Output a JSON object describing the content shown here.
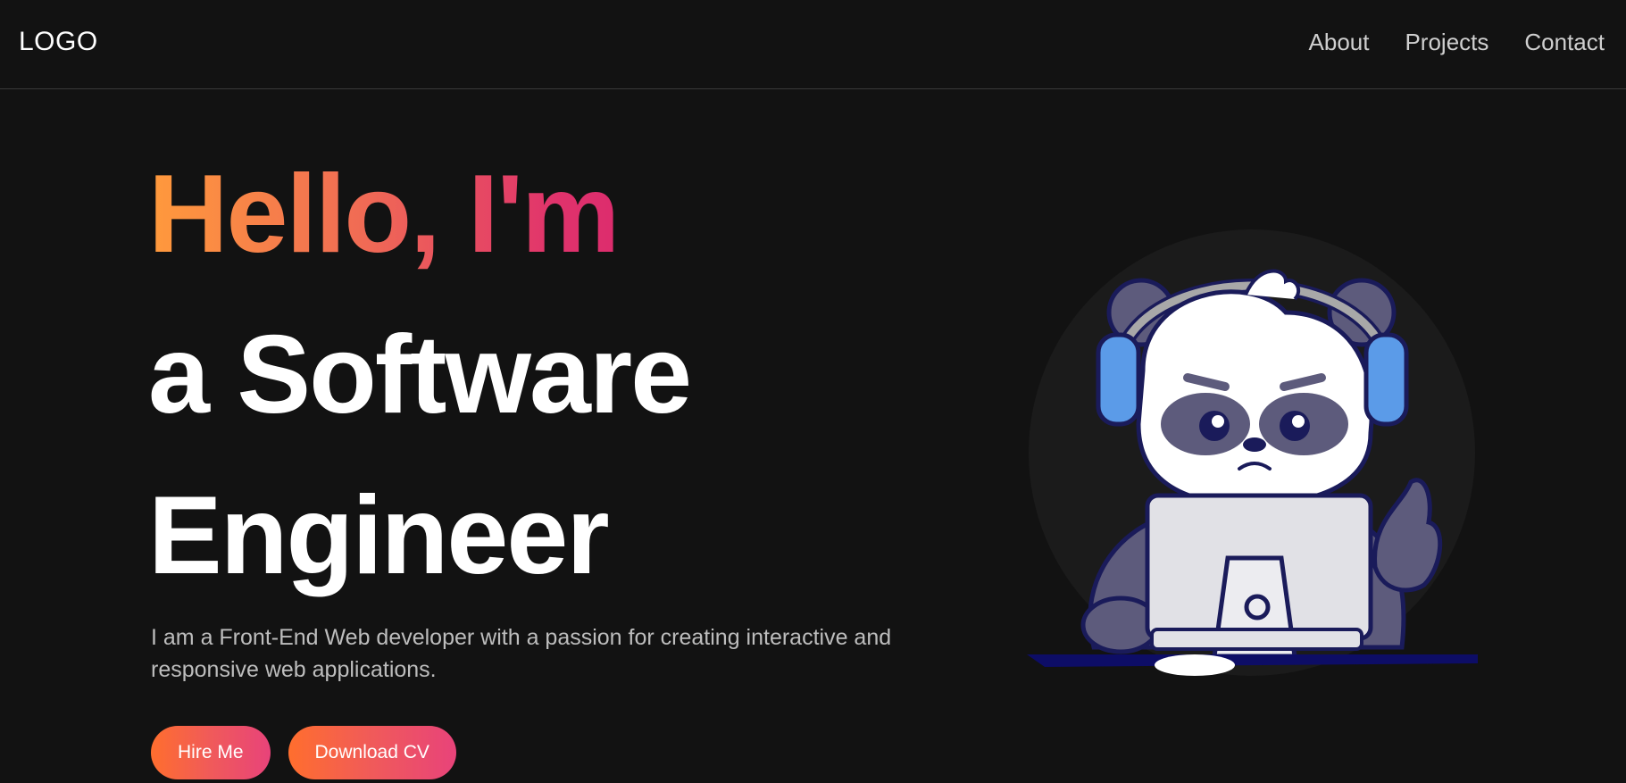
{
  "nav": {
    "logo": "LOGO",
    "links": [
      "About",
      "Projects",
      "Contact"
    ]
  },
  "hero": {
    "greeting": "Hello, I'm",
    "title_line_2": "a Software",
    "title_line_3": "Engineer",
    "description": "I am a Front-End Web developer with a passion for creating interactive and responsive web applications.",
    "buttons": {
      "hire": "Hire Me",
      "download": "Download CV"
    }
  },
  "colors": {
    "background": "#121212",
    "accent_gradient_start": "#ff9a3c",
    "accent_gradient_end": "#d8246f"
  },
  "illustration": {
    "icon": "panda-headphones-laptop-illustration"
  }
}
